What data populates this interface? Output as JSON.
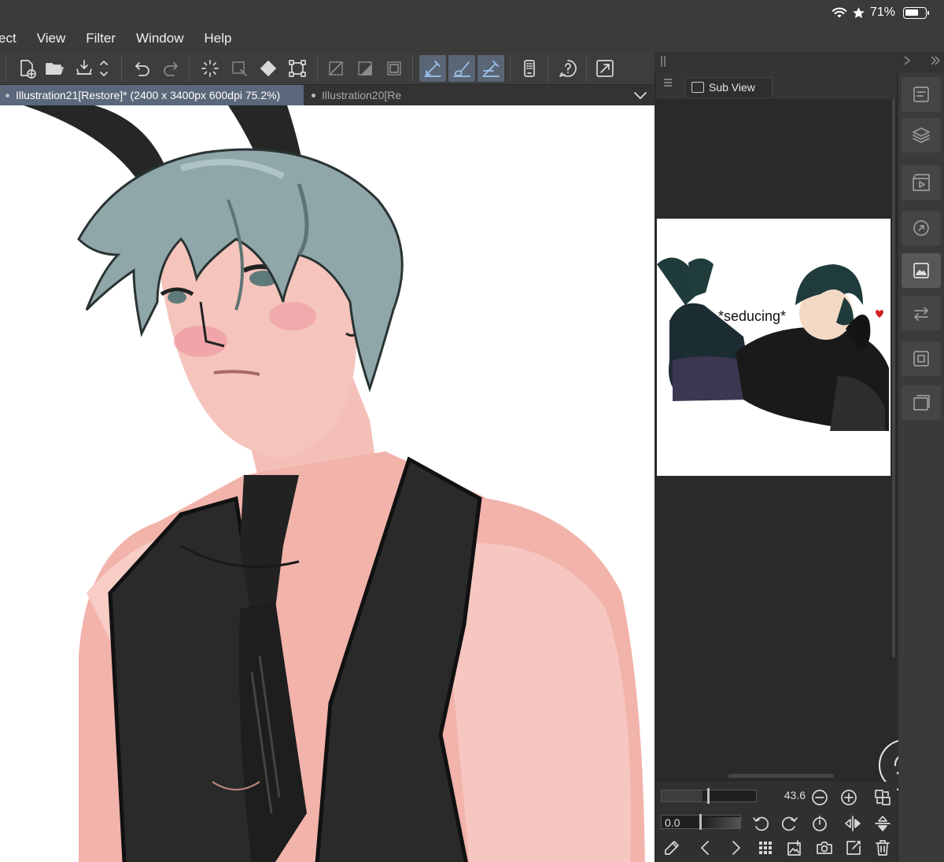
{
  "status_bar": {
    "battery_text": "71%",
    "battery_level": 0.71,
    "icons": [
      "wifi-icon",
      "star-icon",
      "battery-icon"
    ]
  },
  "menu": {
    "items": [
      {
        "label": "ect"
      },
      {
        "label": "View"
      },
      {
        "label": "Filter"
      },
      {
        "label": "Window"
      },
      {
        "label": "Help"
      }
    ]
  },
  "toolbar": {
    "icons": [
      "new-canvas-icon",
      "open-folder-icon",
      "save-icon",
      "reorder-icon",
      "undo-icon",
      "redo-icon",
      "loading-spinner-icon",
      "select-layer-icon",
      "fill-icon",
      "transform-icon",
      "deselect-icon",
      "invert-selection-icon",
      "selection-border-icon",
      "pen-tool-icon",
      "brush-tool-icon",
      "eraser-tool-icon",
      "companion-mode-icon",
      "help-icon",
      "expand-icon"
    ],
    "active": [
      "pen-tool-icon",
      "brush-tool-icon",
      "eraser-tool-icon"
    ],
    "accent_color": "#5a6675"
  },
  "tabs": [
    {
      "label": "Illustration21[Restore]* (2400 x 3400px 600dpi 75.2%)",
      "active": true
    },
    {
      "label": "Illustration20[Re",
      "active": false
    }
  ],
  "sub_view": {
    "tab_label": "Sub View",
    "caption": "*seducing*"
  },
  "navigator": {
    "zoom_value": "43.6",
    "zoom_fraction": 0.43,
    "angle_value": "0.0"
  },
  "sidebar": {
    "icons": [
      "properties-icon",
      "layers-icon",
      "animation-icon",
      "navigator-icon",
      "sub-view-icon",
      "auto-actions-icon",
      "layer-property-icon",
      "material-icon"
    ],
    "active": "sub-view-icon"
  },
  "colors": {
    "chrome": "#3b3b3b",
    "active_tab": "#5b677a",
    "panel": "#2a2a2a"
  }
}
